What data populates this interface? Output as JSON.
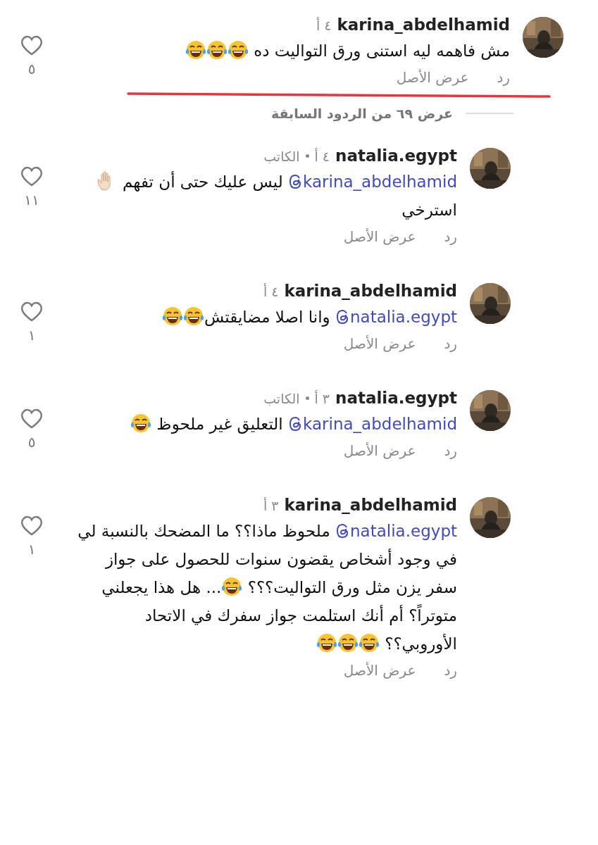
{
  "comment": {
    "username": "karina_abdelhamid",
    "time": "٤ أ",
    "underlined": true,
    "liked": false,
    "likes": "٥",
    "reply_label": "رد",
    "original_label": "عرض الأصل",
    "avatar": {
      "kind": "picture"
    },
    "body": [
      {
        "kind": "text",
        "text": "مش فاهمه ليه استنى ورق التواليت ده "
      },
      {
        "kind": "laugh-emoji"
      },
      {
        "kind": "laugh-emoji"
      },
      {
        "kind": "laugh-emoji"
      }
    ]
  },
  "more_replies": "عرض ٦٩ من الردود السابقة",
  "replies": [
    {
      "username": "natalia.egypt",
      "time": "٤ أ",
      "author_label": "الكاتب",
      "underlined": false,
      "liked": false,
      "likes": "١١",
      "reply_label": "رد",
      "original_label": "عرض الأصل",
      "avatar": {
        "kind": "picture"
      },
      "body": [
        {
          "kind": "mention",
          "text": "karina_abdelhamid"
        },
        {
          "kind": "text",
          "text": " ليس عليك حتى أن تفهم "
        },
        {
          "kind": "wave-emoji"
        },
        {
          "kind": "text",
          "text": " استرخي"
        }
      ]
    },
    {
      "username": "karina_abdelhamid",
      "time": "٤ أ",
      "underlined": false,
      "liked": false,
      "likes": "١",
      "reply_label": "رد",
      "original_label": "عرض الأصل",
      "avatar": {
        "kind": "picture"
      },
      "body": [
        {
          "kind": "mention",
          "text": "natalia.egypt"
        },
        {
          "kind": "text",
          "text": " وانا اصلا مضايقتش"
        },
        {
          "kind": "laugh-emoji"
        },
        {
          "kind": "laugh-emoji"
        }
      ]
    },
    {
      "username": "natalia.egypt",
      "time": "٣ أ",
      "author_label": "الكاتب",
      "underlined": false,
      "liked": false,
      "likes": "٥",
      "reply_label": "رد",
      "original_label": "عرض الأصل",
      "avatar": {
        "kind": "picture"
      },
      "body": [
        {
          "kind": "mention",
          "text": "karina_abdelhamid"
        },
        {
          "kind": "text",
          "text": " التعليق غير ملحوظ "
        },
        {
          "kind": "laugh-emoji"
        }
      ]
    },
    {
      "username": "karina_abdelhamid",
      "time": "٣ أ",
      "underlined": false,
      "liked": false,
      "likes": "١",
      "reply_label": "رد",
      "original_label": "عرض الأصل",
      "avatar": {
        "kind": "picture"
      },
      "body": [
        {
          "kind": "mention",
          "text": "natalia.egypt"
        },
        {
          "kind": "text",
          "text": " ملحوظ ماذا؟؟ ما المضحك بالنسبة لي في وجود أشخاص يقضون سنوات للحصول على جواز سفر يزن مثل ورق التواليت؟؟؟ "
        },
        {
          "kind": "laugh-emoji"
        },
        {
          "kind": "text",
          "text": "... هل هذا يجعلني متوتراً؟ أم أنك استلمت جواز سفرك في الاتحاد الأوروبي؟؟ "
        },
        {
          "kind": "laugh-emoji"
        },
        {
          "kind": "laugh-emoji"
        },
        {
          "kind": "laugh-emoji"
        }
      ]
    }
  ]
}
